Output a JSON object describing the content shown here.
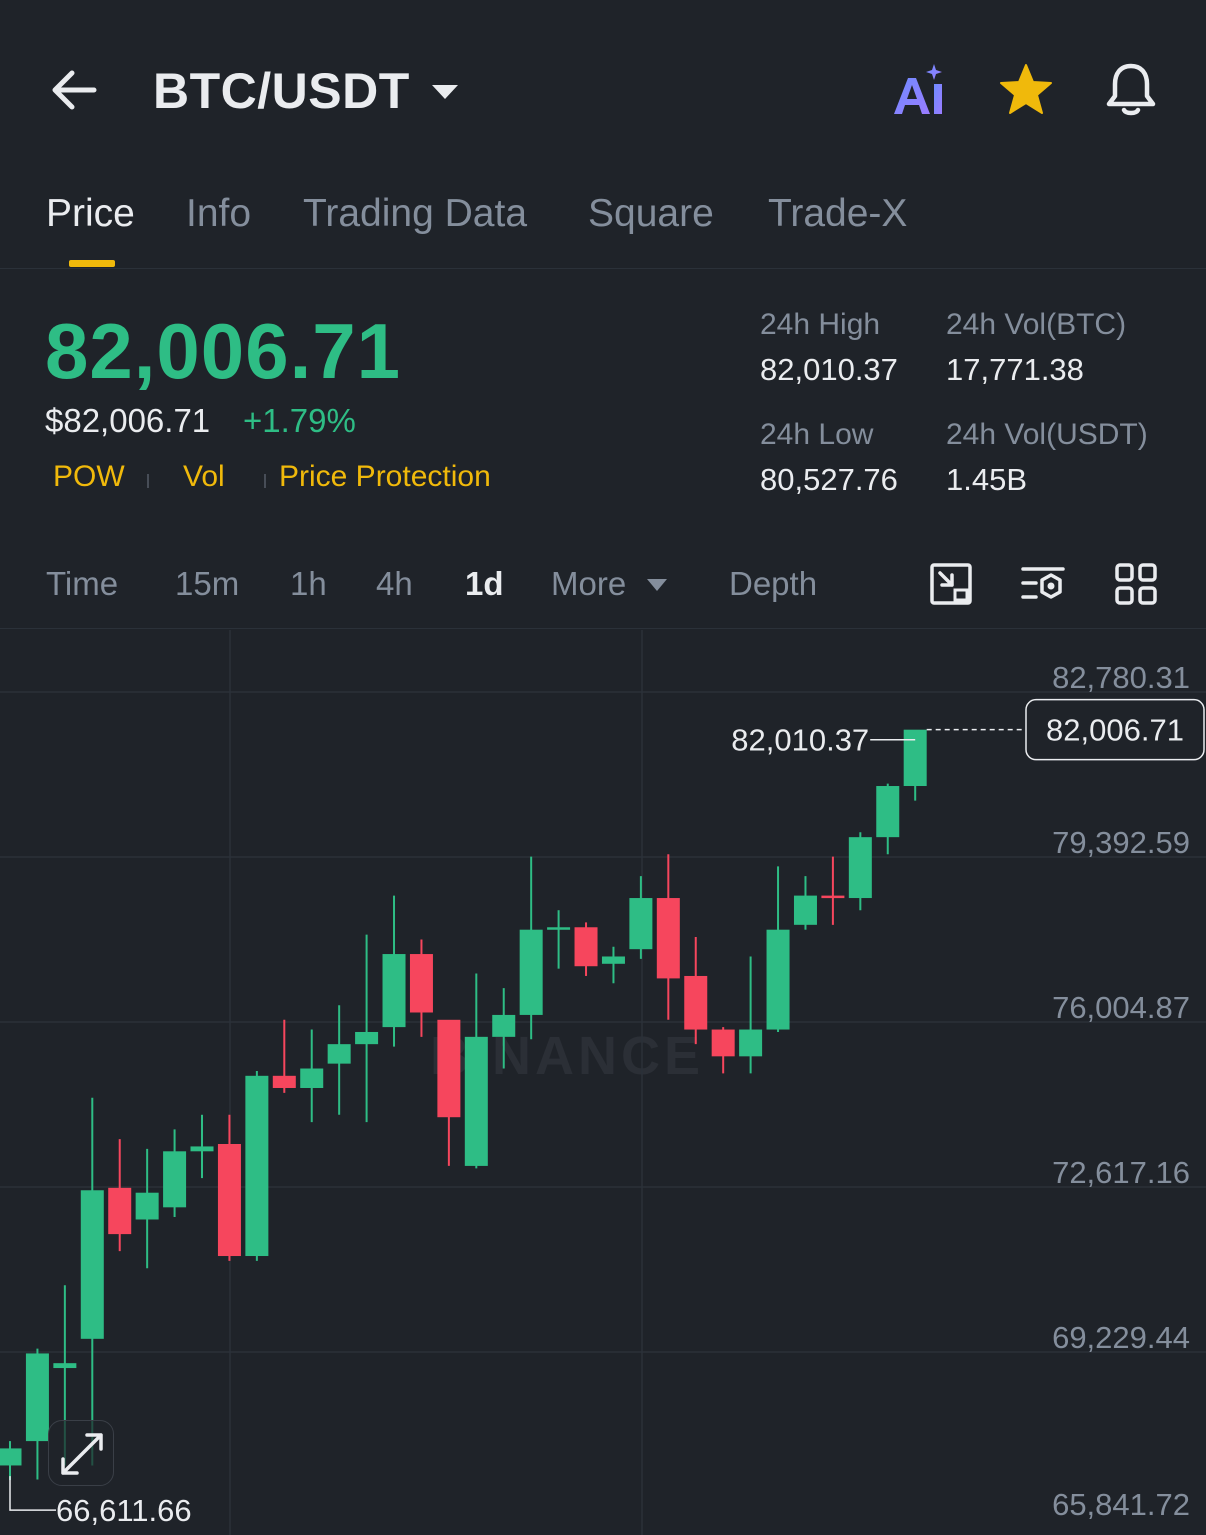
{
  "header": {
    "pair": "BTC/USDT",
    "icons": [
      "back-arrow-icon",
      "caret-down-icon",
      "ai-icon",
      "star-icon",
      "bell-icon"
    ]
  },
  "tabs": [
    {
      "label": "Price",
      "active": true
    },
    {
      "label": "Info",
      "active": false
    },
    {
      "label": "Trading Data",
      "active": false
    },
    {
      "label": "Square",
      "active": false
    },
    {
      "label": "Trade-X",
      "active": false
    }
  ],
  "ticker": {
    "last_price": "82,006.71",
    "usd_price": "$82,006.71",
    "change": "+1.79%",
    "tags": [
      "POW",
      "Vol",
      "Price Protection"
    ],
    "high_label": "24h High",
    "high_value": "82,010.37",
    "low_label": "24h Low",
    "low_value": "80,527.76",
    "vol_btc_label": "24h Vol(BTC)",
    "vol_btc_value": "17,771.38",
    "vol_usdt_label": "24h Vol(USDT)",
    "vol_usdt_value": "1.45B"
  },
  "intervals": {
    "items": [
      {
        "label": "Time",
        "active": false
      },
      {
        "label": "15m",
        "active": false
      },
      {
        "label": "1h",
        "active": false
      },
      {
        "label": "4h",
        "active": false
      },
      {
        "label": "1d",
        "active": true
      },
      {
        "label": "More",
        "active": false
      },
      {
        "label": "Depth",
        "active": false
      }
    ],
    "tools": [
      "chart-expand-icon",
      "indicator-settings-icon",
      "layout-grid-icon"
    ]
  },
  "colors": {
    "up": "#2ebd85",
    "down": "#f6465d",
    "accent": "#f0b90b",
    "background": "#1f2329"
  },
  "chart_data": {
    "type": "candlestick",
    "y_ticks": [
      "82,780.31",
      "79,392.59",
      "76,004.87",
      "72,617.16",
      "69,229.44",
      "65,841.72"
    ],
    "current_price_label": "82,006.71",
    "max_label": "82,010.37",
    "min_label": "66,611.66",
    "watermark": "BINANCE",
    "candles": [
      {
        "o": 66900,
        "h": 67400,
        "l": 66600,
        "c": 67250
      },
      {
        "o": 67400,
        "h": 69300,
        "l": 66612,
        "c": 69200
      },
      {
        "o": 68900,
        "h": 70600,
        "l": 66900,
        "c": 69000
      },
      {
        "o": 69500,
        "h": 74450,
        "l": 66900,
        "c": 72550
      },
      {
        "o": 72600,
        "h": 73600,
        "l": 71300,
        "c": 71650
      },
      {
        "o": 71950,
        "h": 73400,
        "l": 70950,
        "c": 72500
      },
      {
        "o": 72200,
        "h": 73800,
        "l": 72000,
        "c": 73350
      },
      {
        "o": 73350,
        "h": 74100,
        "l": 72800,
        "c": 73450
      },
      {
        "o": 73500,
        "h": 74100,
        "l": 71100,
        "c": 71200
      },
      {
        "o": 71200,
        "h": 75000,
        "l": 71100,
        "c": 74900
      },
      {
        "o": 74900,
        "h": 76050,
        "l": 74550,
        "c": 74650
      },
      {
        "o": 74650,
        "h": 75850,
        "l": 73950,
        "c": 75050
      },
      {
        "o": 75150,
        "h": 76350,
        "l": 74100,
        "c": 75550
      },
      {
        "o": 75550,
        "h": 77800,
        "l": 73950,
        "c": 75800
      },
      {
        "o": 75900,
        "h": 78600,
        "l": 75500,
        "c": 77400
      },
      {
        "o": 77400,
        "h": 77700,
        "l": 75700,
        "c": 76200
      },
      {
        "o": 76050,
        "h": 75650,
        "l": 73050,
        "c": 74050
      },
      {
        "o": 73050,
        "h": 77000,
        "l": 73000,
        "c": 75700
      },
      {
        "o": 75700,
        "h": 76700,
        "l": 75050,
        "c": 76150
      },
      {
        "o": 76150,
        "h": 79400,
        "l": 75650,
        "c": 77900
      },
      {
        "o": 77900,
        "h": 78300,
        "l": 77100,
        "c": 77950
      },
      {
        "o": 77950,
        "h": 78050,
        "l": 76950,
        "c": 77150
      },
      {
        "o": 77200,
        "h": 77550,
        "l": 76800,
        "c": 77350
      },
      {
        "o": 77500,
        "h": 79000,
        "l": 77300,
        "c": 78550
      },
      {
        "o": 78550,
        "h": 79450,
        "l": 76050,
        "c": 76900
      },
      {
        "o": 76950,
        "h": 77750,
        "l": 75550,
        "c": 75850
      },
      {
        "o": 75850,
        "h": 75900,
        "l": 74950,
        "c": 75300
      },
      {
        "o": 75300,
        "h": 77350,
        "l": 74950,
        "c": 75850
      },
      {
        "o": 75850,
        "h": 79200,
        "l": 75800,
        "c": 77900
      },
      {
        "o": 78000,
        "h": 79000,
        "l": 77900,
        "c": 78600
      },
      {
        "o": 78600,
        "h": 79400,
        "l": 78000,
        "c": 78550
      },
      {
        "o": 78550,
        "h": 79900,
        "l": 78300,
        "c": 79800
      },
      {
        "o": 79800,
        "h": 80900,
        "l": 79450,
        "c": 80850
      },
      {
        "o": 80850,
        "h": 81800,
        "l": 80550,
        "c": 82006.71
      }
    ],
    "y_range": [
      65841.72,
      82780.31
    ]
  }
}
